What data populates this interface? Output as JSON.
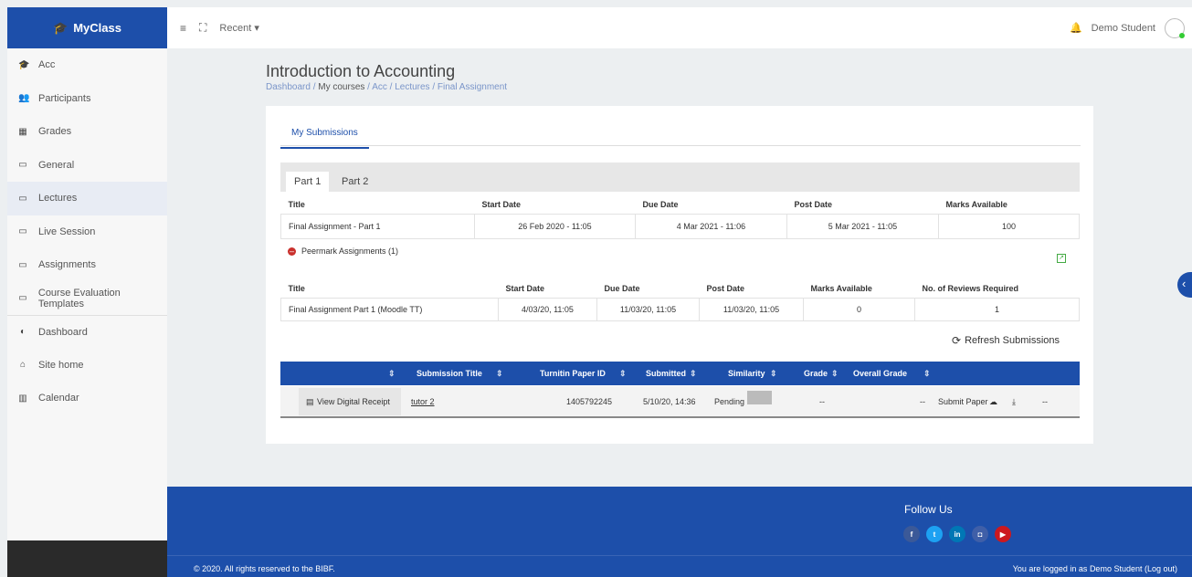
{
  "brand": {
    "name": "MyClass"
  },
  "sidebar": {
    "items": [
      {
        "label": "Acc",
        "icon": "graduation-cap-icon"
      },
      {
        "label": "Participants",
        "icon": "users-icon"
      },
      {
        "label": "Grades",
        "icon": "table-icon"
      },
      {
        "label": "General",
        "icon": "folder-icon"
      },
      {
        "label": "Lectures",
        "icon": "folder-icon"
      },
      {
        "label": "Live Session",
        "icon": "folder-icon"
      },
      {
        "label": "Assignments",
        "icon": "folder-icon"
      },
      {
        "label": "Course Evaluation Templates",
        "icon": "folder-icon"
      },
      {
        "label": "Dashboard",
        "icon": "tachometer-icon"
      },
      {
        "label": "Site home",
        "icon": "home-icon"
      },
      {
        "label": "Calendar",
        "icon": "calendar-icon"
      }
    ],
    "active_index": 4
  },
  "topbar": {
    "recent": "Recent ▾",
    "user": "Demo Student"
  },
  "page": {
    "title": "Introduction to Accounting",
    "breadcrumb": [
      "Dashboard",
      "My courses",
      "Acc",
      "Lectures",
      "Final Assignment"
    ]
  },
  "tabs": {
    "my_submissions": "My Submissions",
    "part1": "Part 1",
    "part2": "Part 2"
  },
  "part_table": {
    "headers": [
      "Title",
      "Start Date",
      "Due Date",
      "Post Date",
      "Marks Available"
    ],
    "row": [
      "Final Assignment - Part 1",
      "26 Feb 2020 - 11:05",
      "4 Mar 2021 - 11:06",
      "5 Mar 2021 - 11:05",
      "100"
    ]
  },
  "peermark": {
    "label": "Peermark Assignments (1)"
  },
  "peer_table": {
    "headers": [
      "Title",
      "Start Date",
      "Due Date",
      "Post Date",
      "Marks Available",
      "No. of Reviews Required"
    ],
    "row": [
      "Final Assignment Part 1 (Moodle TT)",
      "4/03/20, 11:05",
      "11/03/20, 11:05",
      "11/03/20, 11:05",
      "0",
      "1"
    ]
  },
  "refresh": {
    "label": "Refresh Submissions"
  },
  "submissions": {
    "headers": {
      "title": "Submission Title",
      "paper_id": "Turnitin Paper ID",
      "submitted": "Submitted",
      "similarity": "Similarity",
      "grade": "Grade",
      "overall": "Overall Grade"
    },
    "row": {
      "receipt": "View Digital Receipt",
      "title": "tutor 2",
      "paper_id": "1405792245",
      "submitted": "5/10/20, 14:36",
      "similarity": "Pending",
      "grade": "--",
      "overall": "--",
      "submit": "Submit Paper",
      "last": "--"
    }
  },
  "footer": {
    "follow": "Follow Us",
    "socials": [
      {
        "name": "facebook-icon",
        "glyph": "f",
        "color": "#3b5998"
      },
      {
        "name": "twitter-icon",
        "glyph": "t",
        "color": "#1da1f2"
      },
      {
        "name": "linkedin-icon",
        "glyph": "in",
        "color": "#0077b5"
      },
      {
        "name": "instagram-icon",
        "glyph": "◘",
        "color": "#3f5fa8"
      },
      {
        "name": "youtube-icon",
        "glyph": "▶",
        "color": "#cc181e"
      }
    ],
    "copyright": "© 2020. All rights reserved to the BIBF.",
    "logged_in": "You are logged in as Demo Student (Log out)"
  },
  "colors": {
    "brand": "#1d4faa",
    "sidebar_dark": "#2a2a2a"
  }
}
